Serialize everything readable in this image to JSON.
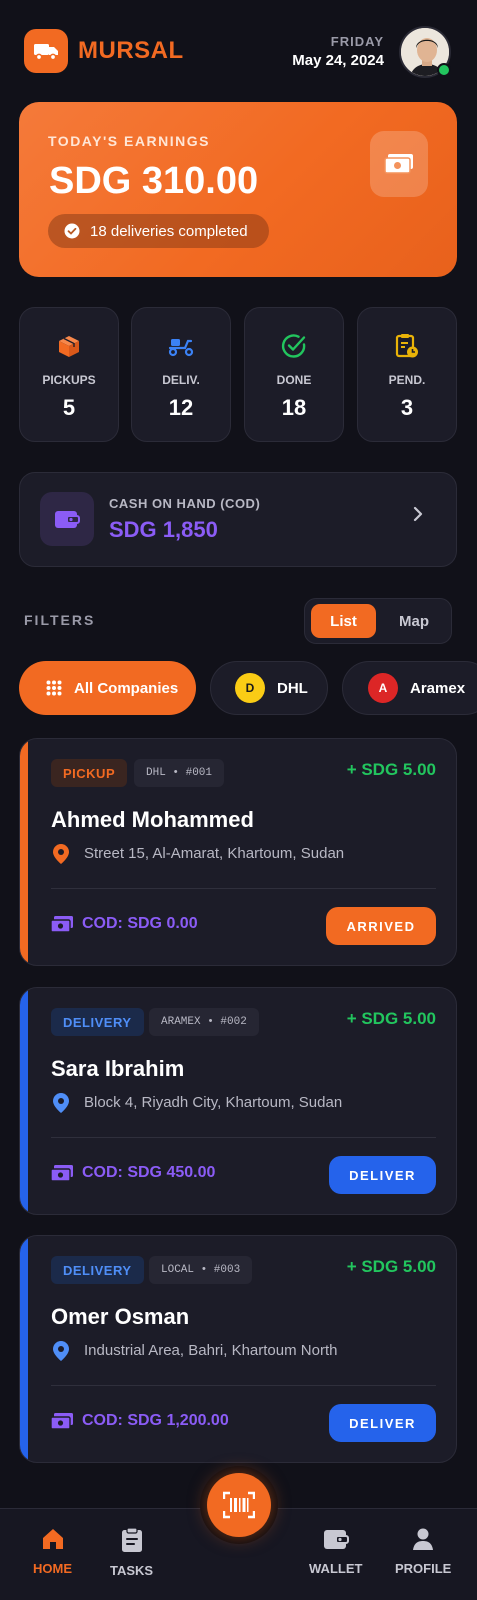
{
  "app": {
    "name": "MURSAL",
    "brand_color": "#f26a22"
  },
  "header": {
    "day": "FRIDAY",
    "date": "May 24, 2024",
    "avatar_icon": "user-avatar",
    "status": "online"
  },
  "earnings": {
    "label": "TODAY'S EARNINGS",
    "amount": "SDG 310.00",
    "completed": "18 deliveries completed",
    "icon": "cash-icon"
  },
  "stats": [
    {
      "label": "PICKUPS",
      "value": "5",
      "icon": "box-icon",
      "color": "#f26a22"
    },
    {
      "label": "DELIV.",
      "value": "12",
      "icon": "scooter-icon",
      "color": "#3b82f6"
    },
    {
      "label": "DONE",
      "value": "18",
      "icon": "check-circle-icon",
      "color": "#22c55e"
    },
    {
      "label": "PEND.",
      "value": "3",
      "icon": "clipboard-clock-icon",
      "color": "#eab308"
    }
  ],
  "cod": {
    "label": "CASH ON HAND (COD)",
    "amount": "SDG 1,850",
    "icon": "wallet-icon"
  },
  "filters": {
    "label": "FILTERS",
    "view_toggle": [
      "List",
      "Map"
    ],
    "active_view": "List",
    "chips": [
      {
        "label": "All Companies",
        "icon": "grid-icon",
        "active": true
      },
      {
        "label": "DHL",
        "badge": "D",
        "badge_color": "#facc15"
      },
      {
        "label": "Aramex",
        "badge": "A",
        "badge_color": "#dc2626"
      }
    ]
  },
  "tasks": [
    {
      "type": "PICKUP",
      "ref": "DHL • #001",
      "fee": "+ SDG 5.00",
      "customer": "Ahmed Mohammed",
      "address": "Street 15, Al-Amarat, Khartoum, Sudan",
      "cod": "COD: SDG 0.00",
      "action": "ARRIVED",
      "accent": "#f26a22"
    },
    {
      "type": "DELIVERY",
      "ref": "ARAMEX • #002",
      "fee": "+ SDG 5.00",
      "customer": "Sara Ibrahim",
      "address": "Block 4, Riyadh City, Khartoum, Sudan",
      "cod": "COD: SDG 450.00",
      "action": "DELIVER",
      "accent": "#2563eb"
    },
    {
      "type": "DELIVERY",
      "ref": "LOCAL • #003",
      "fee": "+ SDG 5.00",
      "customer": "Omer Osman",
      "address": "Industrial Area, Bahri, Khartoum North",
      "cod": "COD: SDG 1,200.00",
      "action": "DELIVER",
      "accent": "#2563eb"
    }
  ],
  "nav": {
    "items": [
      {
        "label": "HOME",
        "icon": "home-icon",
        "active": true
      },
      {
        "label": "TASKS",
        "icon": "clipboard-icon"
      },
      {
        "label": "WALLET",
        "icon": "wallet-icon"
      },
      {
        "label": "PROFILE",
        "icon": "profile-icon"
      }
    ],
    "scan_icon": "barcode-scan-icon"
  }
}
